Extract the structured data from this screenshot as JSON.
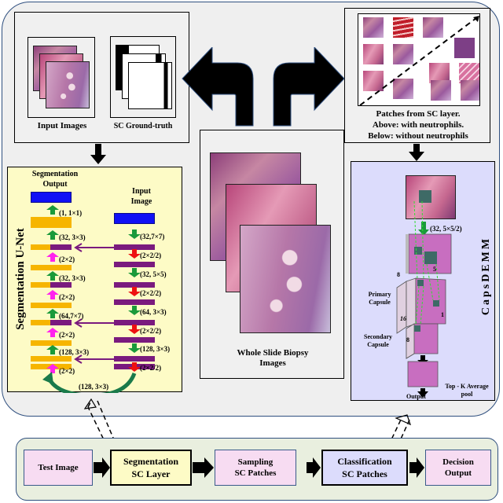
{
  "top_left": {
    "input_images_label": "Input Images",
    "ground_truth_label": "SC Ground-truth"
  },
  "top_right": {
    "caption_line1": "Patches from SC layer.",
    "caption_line2": "Above: with neutrophils.",
    "caption_line3": "Below: without neutrophils"
  },
  "center": {
    "wsi_label_line1": "Whole Slide Biopsy",
    "wsi_label_line2": "Images"
  },
  "unet": {
    "title": "Segmentation U-Net",
    "output_label_line1": "Segmentation",
    "output_label_line2": "Output",
    "input_label_line1": "Input",
    "input_label_line2": "Image",
    "decoder_ops": [
      "(1, 1×1)",
      "(32, 3×3)",
      "(2×2)",
      "(32, 3×3)",
      "(2×2)",
      "(64,7×7)",
      "(2×2)",
      "(128, 3×3)",
      "(2×2)"
    ],
    "encoder_ops": [
      "(32,7×7)",
      "(2×2/2)",
      "(32, 5×5)",
      "(2×2/2)",
      "(64, 3×3)",
      "(2×2/2)",
      "(128, 3×3)",
      "(2×2/2)"
    ],
    "bottleneck_op": "(128, 3×3)",
    "colors": {
      "decoder": "#f6b500",
      "encoder": "#7a1a7e",
      "io": "#1010f5",
      "conv_arrow": "#1a9a3a",
      "pool_arrow": "#ee1111",
      "upsample_arrow": "#ff22ee",
      "skip": "#7a1a7e",
      "bg": "#fdfbc6"
    }
  },
  "capsdemm": {
    "title": "CapsDEMM",
    "conv_op": "(32, 5×5/2)",
    "dim_5": "5",
    "dim_8_top": "8",
    "dim_1": "1",
    "dim_16": "16",
    "dim_8_side": "8",
    "primary_line1": "Primary",
    "primary_line2": "Capsule",
    "secondary_line1": "Secondary",
    "secondary_line2": "Capsule",
    "pool_line1": "Top - K Average",
    "pool_line2": "pool",
    "output_label": "Output",
    "colors": {
      "bg": "#dcdcfc",
      "capsule": "#c86ec0"
    }
  },
  "pipeline": {
    "steps": [
      {
        "line1": "Test Image",
        "line2": "",
        "color": "#f7dcf2"
      },
      {
        "line1": "Segmentation",
        "line2": "SC Layer",
        "color": "#fdfbc6"
      },
      {
        "line1": "Sampling",
        "line2": "SC Patches",
        "color": "#f7dcf2"
      },
      {
        "line1": "Classification",
        "line2": "SC Patches",
        "color": "#dcdcfc"
      },
      {
        "line1": "Decision",
        "line2": "Output",
        "color": "#f7dcf2"
      }
    ]
  }
}
